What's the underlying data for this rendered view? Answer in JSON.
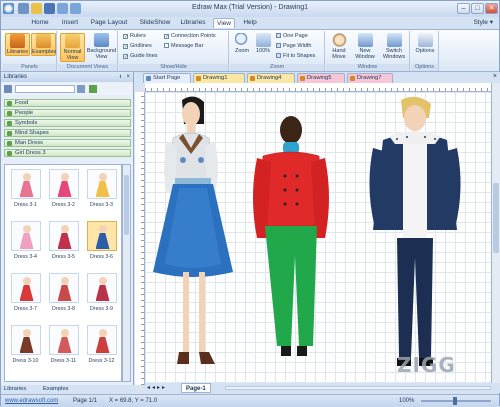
{
  "window": {
    "title": "Edraw Max (Trial Version) - Drawing1",
    "min": "–",
    "max": "□",
    "close": "✕"
  },
  "menu": [
    "Home",
    "Insert",
    "Page Layout",
    "SlideShow",
    "Libraries",
    "View",
    "Help"
  ],
  "menu_active": "View",
  "style_link": "Style ▾",
  "ribbon": {
    "panels": {
      "label": "Panels",
      "libraries": "Libraries",
      "examples": "Examples"
    },
    "document_views": {
      "label": "Document Views",
      "normal": "Normal View",
      "background": "Background View"
    },
    "show_hide": {
      "label": "Show/Hide",
      "rulers": "Rulers",
      "gridlines": "Gridlines",
      "guide_lines": "Guide lines",
      "connection_points": "Connection Points",
      "message_bar": "Message Bar"
    },
    "zoom": {
      "label": "Zoom",
      "zoom": "Zoom",
      "percent": "100%",
      "one_page": "One Page",
      "page_width": "Page Width",
      "fit_to_shapes": "Fit to Shapes"
    },
    "window": {
      "label": "Window",
      "hand_move": "Hand Move",
      "new_window": "New Window",
      "switch_windows": "Switch Windows"
    },
    "options": {
      "label": "Options",
      "options": "Options"
    }
  },
  "libraries": {
    "header": "Libraries",
    "categories": [
      "Food",
      "People",
      "Symbols",
      "Mind Shapes",
      "Man Dress",
      "Girl Dress 3"
    ],
    "shapes": [
      "Dress 3-1",
      "Dress 3-2",
      "Dress 3-3",
      "Dress 3-4",
      "Dress 3-5",
      "Dress 3-6",
      "Dress 3-7",
      "Dress 3-8",
      "Dress 3-9",
      "Dress 3-10",
      "Dress 3-11",
      "Dress 3-12"
    ],
    "shape_colors": [
      "#e8758f",
      "#e6467a",
      "#f1c04a",
      "#f0a0c0",
      "#c0304a",
      "#2d5da8",
      "#d83a3a",
      "#c84a4a",
      "#b8324a",
      "#7a3a2a",
      "#d25a5a",
      "#cc3f3f"
    ],
    "selected": "Dress 3-6",
    "tabs": [
      "Libraries",
      "Examples"
    ]
  },
  "doc_tabs": [
    "Start Page",
    "Drawing1",
    "Drawing4",
    "Drawing5",
    "Drawing7"
  ],
  "doc_tab_colors": [
    "#e6eef9",
    "#fbe7a4",
    "#fbe7a4",
    "#f4c6d6",
    "#f4c6d6"
  ],
  "page_tab": "Page-1",
  "status": {
    "site": "www.edrawsoft.com",
    "page": "Page 1/1",
    "coords": "X = 69.8, Y = 71.0",
    "zoom": "100%"
  },
  "watermark": "ZIGG"
}
